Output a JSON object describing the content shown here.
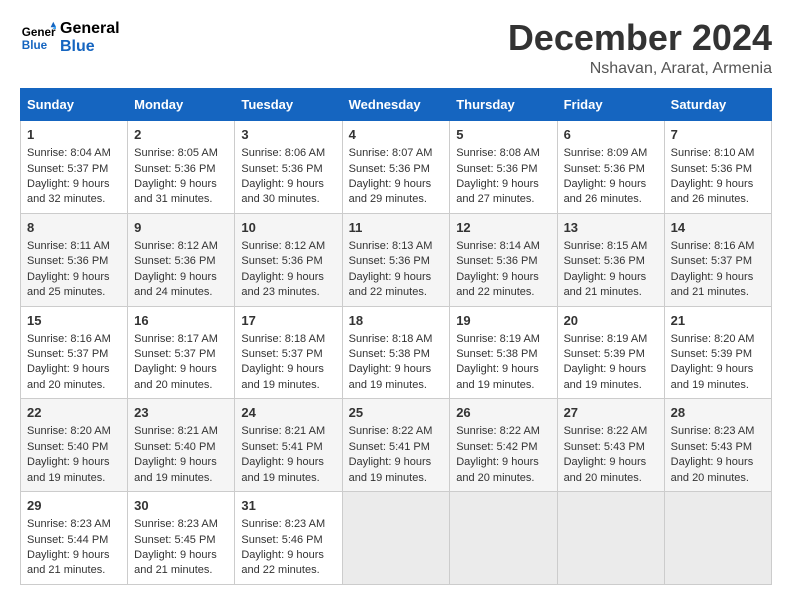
{
  "header": {
    "logo_general": "General",
    "logo_blue": "Blue",
    "month_title": "December 2024",
    "location": "Nshavan, Ararat, Armenia"
  },
  "weekdays": [
    "Sunday",
    "Monday",
    "Tuesday",
    "Wednesday",
    "Thursday",
    "Friday",
    "Saturday"
  ],
  "weeks": [
    [
      {
        "day": "1",
        "sunrise": "Sunrise: 8:04 AM",
        "sunset": "Sunset: 5:37 PM",
        "daylight": "Daylight: 9 hours and 32 minutes."
      },
      {
        "day": "2",
        "sunrise": "Sunrise: 8:05 AM",
        "sunset": "Sunset: 5:36 PM",
        "daylight": "Daylight: 9 hours and 31 minutes."
      },
      {
        "day": "3",
        "sunrise": "Sunrise: 8:06 AM",
        "sunset": "Sunset: 5:36 PM",
        "daylight": "Daylight: 9 hours and 30 minutes."
      },
      {
        "day": "4",
        "sunrise": "Sunrise: 8:07 AM",
        "sunset": "Sunset: 5:36 PM",
        "daylight": "Daylight: 9 hours and 29 minutes."
      },
      {
        "day": "5",
        "sunrise": "Sunrise: 8:08 AM",
        "sunset": "Sunset: 5:36 PM",
        "daylight": "Daylight: 9 hours and 27 minutes."
      },
      {
        "day": "6",
        "sunrise": "Sunrise: 8:09 AM",
        "sunset": "Sunset: 5:36 PM",
        "daylight": "Daylight: 9 hours and 26 minutes."
      },
      {
        "day": "7",
        "sunrise": "Sunrise: 8:10 AM",
        "sunset": "Sunset: 5:36 PM",
        "daylight": "Daylight: 9 hours and 26 minutes."
      }
    ],
    [
      {
        "day": "8",
        "sunrise": "Sunrise: 8:11 AM",
        "sunset": "Sunset: 5:36 PM",
        "daylight": "Daylight: 9 hours and 25 minutes."
      },
      {
        "day": "9",
        "sunrise": "Sunrise: 8:12 AM",
        "sunset": "Sunset: 5:36 PM",
        "daylight": "Daylight: 9 hours and 24 minutes."
      },
      {
        "day": "10",
        "sunrise": "Sunrise: 8:12 AM",
        "sunset": "Sunset: 5:36 PM",
        "daylight": "Daylight: 9 hours and 23 minutes."
      },
      {
        "day": "11",
        "sunrise": "Sunrise: 8:13 AM",
        "sunset": "Sunset: 5:36 PM",
        "daylight": "Daylight: 9 hours and 22 minutes."
      },
      {
        "day": "12",
        "sunrise": "Sunrise: 8:14 AM",
        "sunset": "Sunset: 5:36 PM",
        "daylight": "Daylight: 9 hours and 22 minutes."
      },
      {
        "day": "13",
        "sunrise": "Sunrise: 8:15 AM",
        "sunset": "Sunset: 5:36 PM",
        "daylight": "Daylight: 9 hours and 21 minutes."
      },
      {
        "day": "14",
        "sunrise": "Sunrise: 8:16 AM",
        "sunset": "Sunset: 5:37 PM",
        "daylight": "Daylight: 9 hours and 21 minutes."
      }
    ],
    [
      {
        "day": "15",
        "sunrise": "Sunrise: 8:16 AM",
        "sunset": "Sunset: 5:37 PM",
        "daylight": "Daylight: 9 hours and 20 minutes."
      },
      {
        "day": "16",
        "sunrise": "Sunrise: 8:17 AM",
        "sunset": "Sunset: 5:37 PM",
        "daylight": "Daylight: 9 hours and 20 minutes."
      },
      {
        "day": "17",
        "sunrise": "Sunrise: 8:18 AM",
        "sunset": "Sunset: 5:37 PM",
        "daylight": "Daylight: 9 hours and 19 minutes."
      },
      {
        "day": "18",
        "sunrise": "Sunrise: 8:18 AM",
        "sunset": "Sunset: 5:38 PM",
        "daylight": "Daylight: 9 hours and 19 minutes."
      },
      {
        "day": "19",
        "sunrise": "Sunrise: 8:19 AM",
        "sunset": "Sunset: 5:38 PM",
        "daylight": "Daylight: 9 hours and 19 minutes."
      },
      {
        "day": "20",
        "sunrise": "Sunrise: 8:19 AM",
        "sunset": "Sunset: 5:39 PM",
        "daylight": "Daylight: 9 hours and 19 minutes."
      },
      {
        "day": "21",
        "sunrise": "Sunrise: 8:20 AM",
        "sunset": "Sunset: 5:39 PM",
        "daylight": "Daylight: 9 hours and 19 minutes."
      }
    ],
    [
      {
        "day": "22",
        "sunrise": "Sunrise: 8:20 AM",
        "sunset": "Sunset: 5:40 PM",
        "daylight": "Daylight: 9 hours and 19 minutes."
      },
      {
        "day": "23",
        "sunrise": "Sunrise: 8:21 AM",
        "sunset": "Sunset: 5:40 PM",
        "daylight": "Daylight: 9 hours and 19 minutes."
      },
      {
        "day": "24",
        "sunrise": "Sunrise: 8:21 AM",
        "sunset": "Sunset: 5:41 PM",
        "daylight": "Daylight: 9 hours and 19 minutes."
      },
      {
        "day": "25",
        "sunrise": "Sunrise: 8:22 AM",
        "sunset": "Sunset: 5:41 PM",
        "daylight": "Daylight: 9 hours and 19 minutes."
      },
      {
        "day": "26",
        "sunrise": "Sunrise: 8:22 AM",
        "sunset": "Sunset: 5:42 PM",
        "daylight": "Daylight: 9 hours and 20 minutes."
      },
      {
        "day": "27",
        "sunrise": "Sunrise: 8:22 AM",
        "sunset": "Sunset: 5:43 PM",
        "daylight": "Daylight: 9 hours and 20 minutes."
      },
      {
        "day": "28",
        "sunrise": "Sunrise: 8:23 AM",
        "sunset": "Sunset: 5:43 PM",
        "daylight": "Daylight: 9 hours and 20 minutes."
      }
    ],
    [
      {
        "day": "29",
        "sunrise": "Sunrise: 8:23 AM",
        "sunset": "Sunset: 5:44 PM",
        "daylight": "Daylight: 9 hours and 21 minutes."
      },
      {
        "day": "30",
        "sunrise": "Sunrise: 8:23 AM",
        "sunset": "Sunset: 5:45 PM",
        "daylight": "Daylight: 9 hours and 21 minutes."
      },
      {
        "day": "31",
        "sunrise": "Sunrise: 8:23 AM",
        "sunset": "Sunset: 5:46 PM",
        "daylight": "Daylight: 9 hours and 22 minutes."
      },
      null,
      null,
      null,
      null
    ]
  ]
}
